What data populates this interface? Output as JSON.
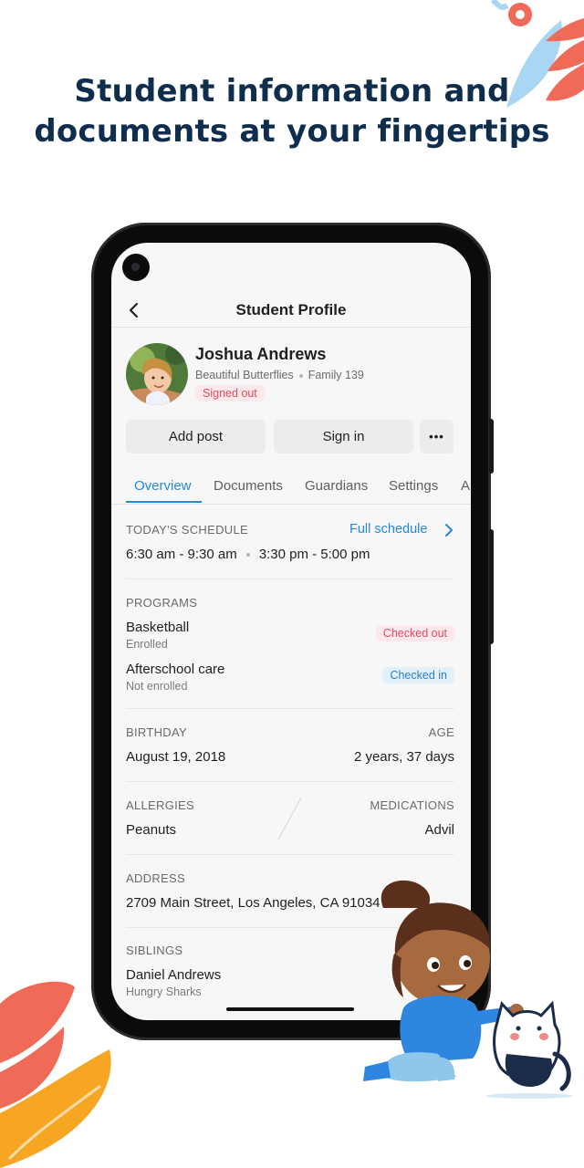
{
  "headline": {
    "line1": "Student information and",
    "line2": "documents at your fingertips"
  },
  "header": {
    "title": "Student Profile"
  },
  "student": {
    "name": "Joshua Andrews",
    "classroom": "Beautiful Butterflies",
    "family": "Family 139",
    "status": "Signed out"
  },
  "actions": {
    "add_post": "Add post",
    "sign_in": "Sign in",
    "more": "•••"
  },
  "tabs": [
    "Overview",
    "Documents",
    "Guardians",
    "Settings",
    "A"
  ],
  "schedule": {
    "label": "TODAY'S SCHEDULE",
    "link": "Full schedule",
    "slot1": "6:30 am - 9:30 am",
    "slot2": "3:30 pm - 5:00 pm"
  },
  "programs": {
    "label": "PROGRAMS",
    "items": [
      {
        "name": "Basketball",
        "enrollment": "Enrolled",
        "status": "Checked out"
      },
      {
        "name": "Afterschool care",
        "enrollment": "Not enrolled",
        "status": "Checked in"
      }
    ]
  },
  "birthday": {
    "label": "BIRTHDAY",
    "value": "August 19, 2018",
    "age_label": "AGE",
    "age_value": "2 years, 37 days"
  },
  "health": {
    "allergies_label": "ALLERGIES",
    "allergies_value": "Peanuts",
    "medications_label": "MEDICATIONS",
    "medications_value": "Advil"
  },
  "address": {
    "label": "ADDRESS",
    "value": "2709 Main Street, Los Angeles, CA 91034"
  },
  "siblings": {
    "label": "SIBLINGS",
    "name": "Daniel Andrews",
    "classroom": "Hungry Sharks"
  },
  "colors": {
    "accent": "#2a88d8",
    "headline": "#0f2d4c",
    "danger": "#de4c5f"
  }
}
